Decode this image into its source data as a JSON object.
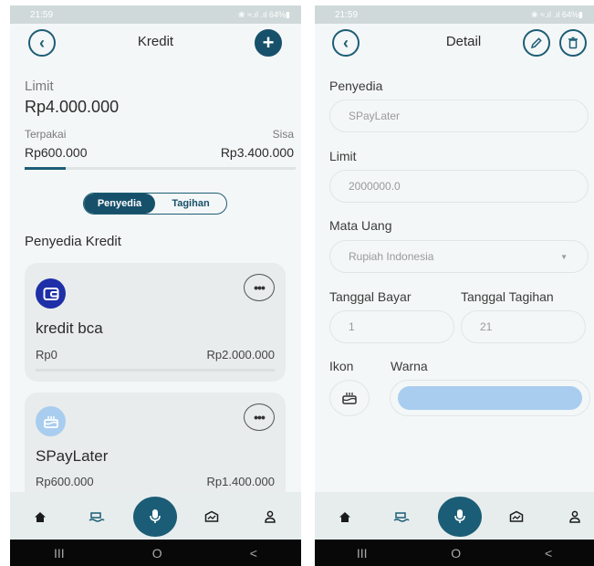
{
  "left": {
    "status": {
      "time": "21:59",
      "indicators": "❀ ≈.ıl .ıl 64%▮"
    },
    "title": "Kredit",
    "limit_label": "Limit",
    "limit_value": "Rp4.000.000",
    "used_label": "Terpakai",
    "remaining_label": "Sisa",
    "used_value": "Rp600.000",
    "remaining_value": "Rp3.400.000",
    "used_fraction": 0.15,
    "tabs": [
      "Penyedia",
      "Tagihan"
    ],
    "section_title": "Penyedia Kredit",
    "cards": [
      {
        "name": "kredit bca",
        "used": "Rp0",
        "limit": "Rp2.000.000",
        "icon": "wallet-icon",
        "icon_bg": "#1e2fa8"
      },
      {
        "name": "SPayLater",
        "used": "Rp600.000",
        "limit": "Rp1.400.000",
        "icon": "cake-icon",
        "icon_bg": "#a9cdef"
      }
    ]
  },
  "right": {
    "status": {
      "time": "21:59",
      "indicators": "❀ ≈.ıl .ıl 64%▮"
    },
    "title": "Detail",
    "provider_label": "Penyedia",
    "provider_value": "SPayLater",
    "limit_label": "Limit",
    "limit_value": "2000000.0",
    "currency_label": "Mata Uang",
    "currency_value": "Rupiah Indonesia",
    "pay_date_label": "Tanggal Bayar",
    "bill_date_label": "Tanggal Tagihan",
    "pay_date_value": "1",
    "bill_date_value": "21",
    "icon_label": "Ikon",
    "color_label": "Warna",
    "selected_icon": "cake-icon",
    "selected_color": "#a9cdef"
  },
  "bottom_nav": [
    "home-icon",
    "wallet-wave-icon",
    "mic-icon",
    "savings-icon",
    "profile-icon"
  ],
  "system_nav": {
    "recent": "III",
    "home": "O",
    "back": "<"
  },
  "colors": {
    "accent": "#17506a",
    "background": "#f4f7f7",
    "card": "#e8ecec"
  }
}
